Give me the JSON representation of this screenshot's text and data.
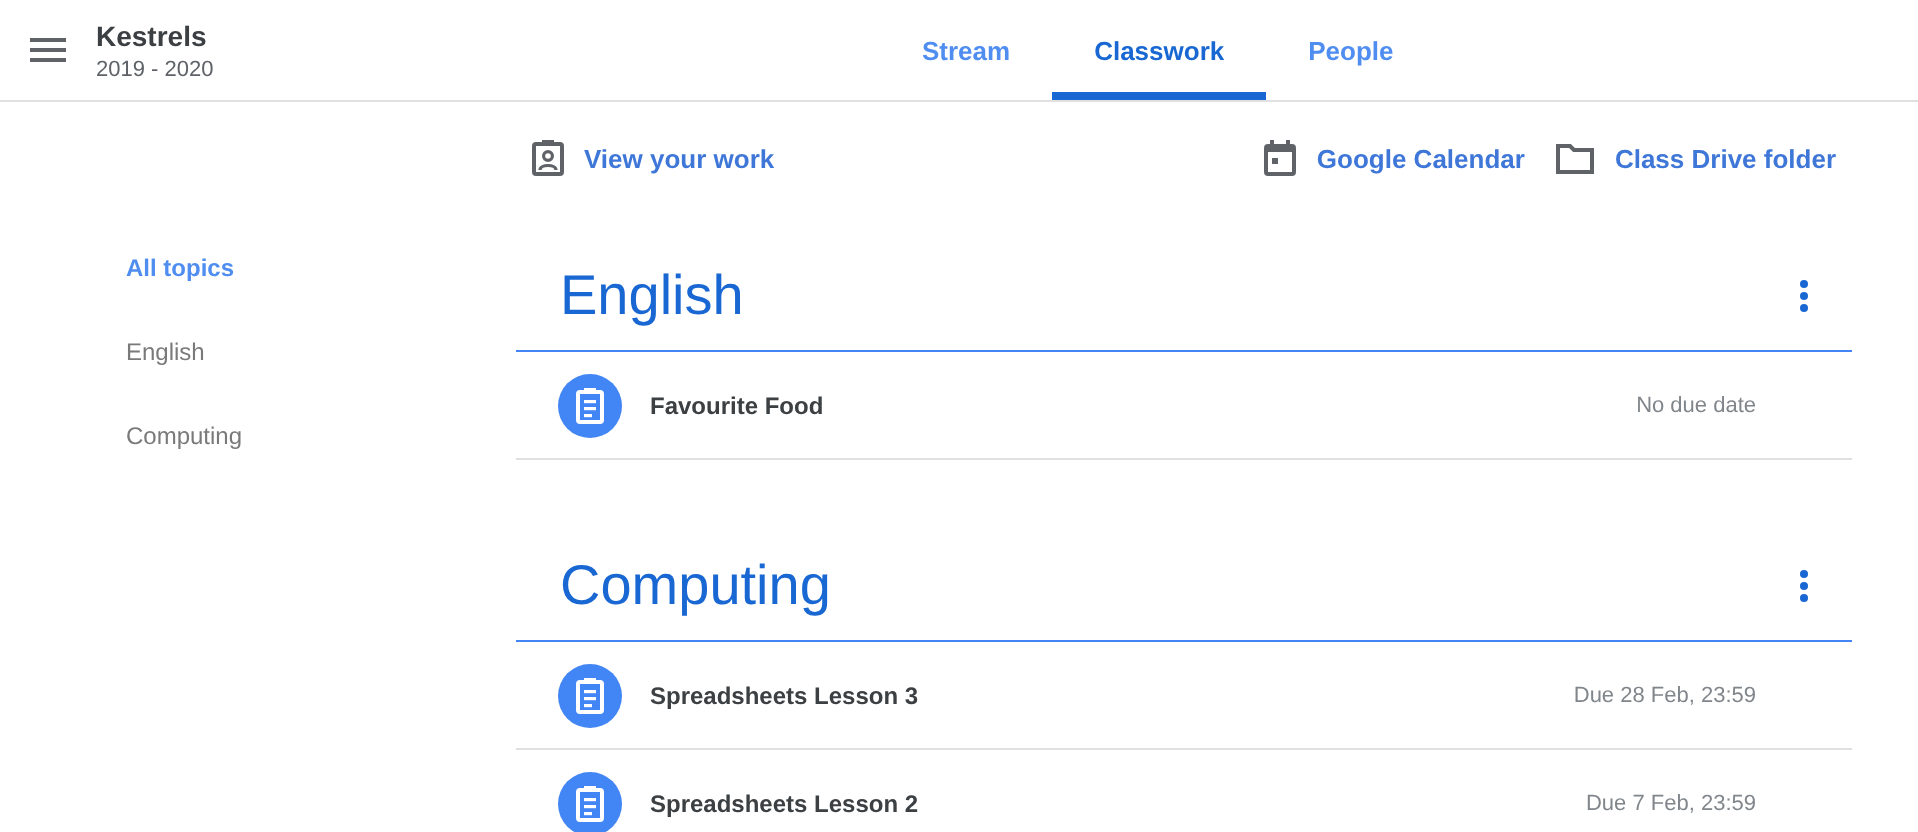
{
  "header": {
    "title": "Kestrels",
    "subtitle": "2019 - 2020"
  },
  "tabs": [
    {
      "label": "Stream",
      "selected": false
    },
    {
      "label": "Classwork",
      "selected": true
    },
    {
      "label": "People",
      "selected": false
    }
  ],
  "toolbar": {
    "view_work": "View your work",
    "calendar": "Google Calendar",
    "drive": "Class Drive folder"
  },
  "sidebar": {
    "items": [
      {
        "label": "All topics",
        "selected": true
      },
      {
        "label": "English",
        "selected": false
      },
      {
        "label": "Computing",
        "selected": false
      }
    ]
  },
  "topics": [
    {
      "title": "English",
      "items": [
        {
          "title": "Favourite Food",
          "due": "No due date"
        }
      ]
    },
    {
      "title": "Computing",
      "items": [
        {
          "title": "Spreadsheets Lesson 3",
          "due": "Due 28 Feb, 23:59"
        },
        {
          "title": "Spreadsheets Lesson 2",
          "due": "Due 7 Feb, 23:59"
        }
      ]
    }
  ]
}
